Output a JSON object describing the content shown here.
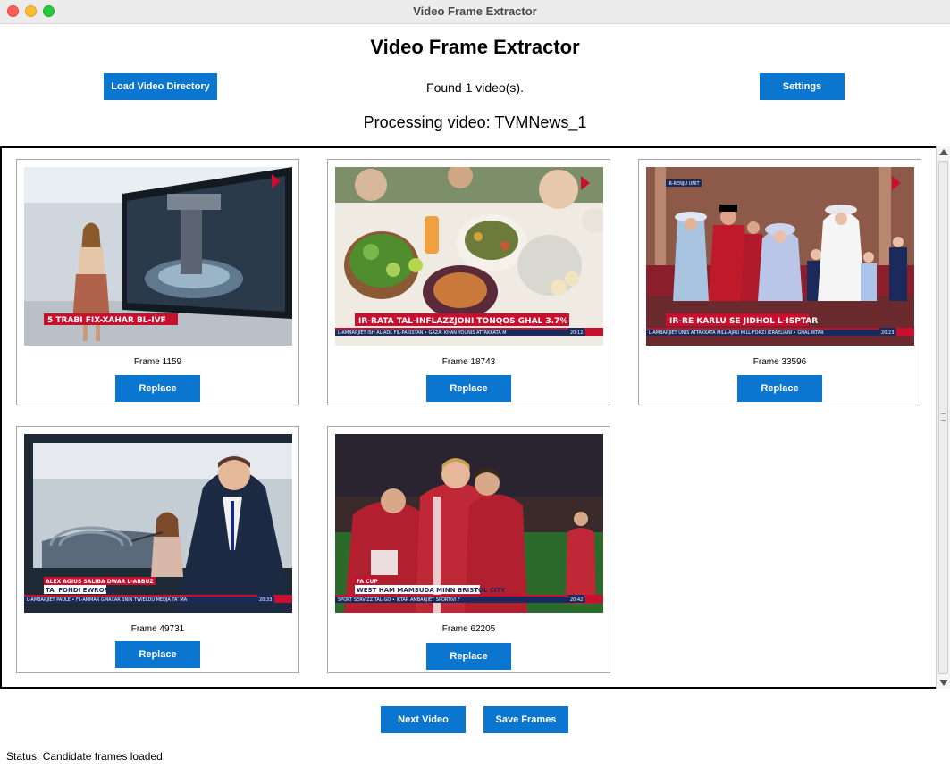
{
  "window": {
    "title": "Video Frame Extractor"
  },
  "header": {
    "title": "Video Frame Extractor",
    "load_button": "Load Video Directory",
    "found_text": "Found 1 video(s).",
    "settings_button": "Settings",
    "processing_text": "Processing video: TVMNews_1"
  },
  "frames": [
    {
      "label": "Frame 1159",
      "replace": "Replace",
      "caption": "5 TRABI FIX-XAHAR BL-IVF"
    },
    {
      "label": "Frame 18743",
      "replace": "Replace",
      "caption": "IR-RATA TAL-INFLAZZJONI TONQOS GHAL 3.7%",
      "ticker": "L-AMBARJIET  ISH AL-ADL FIL-PAKISTAN   •   GAZA: KHAN YOUNIS ATTAKKATA M",
      "time": "20:12"
    },
    {
      "label": "Frame 33596",
      "replace": "Replace",
      "caption": "IR-RE KARLU SE JIDHOL L-ISPTAR",
      "ticker": "L-AMBARJIET  UNIS ATTAKKATA MILL-AJRU MILL-FORZI IZRAELIANI   •   GHAL IKTAR",
      "time": "20:23",
      "tag": "IR-RENJU UNIT"
    },
    {
      "label": "Frame 49731",
      "replace": "Replace",
      "caption": "TA' FONDI EWROPEJ",
      "caption_top": "ALEX AGIUS SALIBA DWAR L-ABBUZ",
      "ticker": "L-AMBARJIET  PAULE   •   FL-AMMAR GMAXAR SNIN TWIELDU MEDJA TA' MA",
      "time": "20:33"
    },
    {
      "label": "Frame 62205",
      "replace": "Replace",
      "caption": "WEST HAM MAMSUDA MINN BRISTOL CITY",
      "caption_top": "FA CUP",
      "ticker": "SPORT  SERVIZZ TAL-GO   •   IKTAR AMBARJIET SPORTIVI F",
      "time": "20:42"
    }
  ],
  "footer": {
    "next_button": "Next Video",
    "save_button": "Save Frames",
    "status": "Status: Candidate frames loaded."
  },
  "colors": {
    "button": "#0a76cf",
    "lower_third": "#c8102e",
    "ticker": "#1a2a5c"
  }
}
